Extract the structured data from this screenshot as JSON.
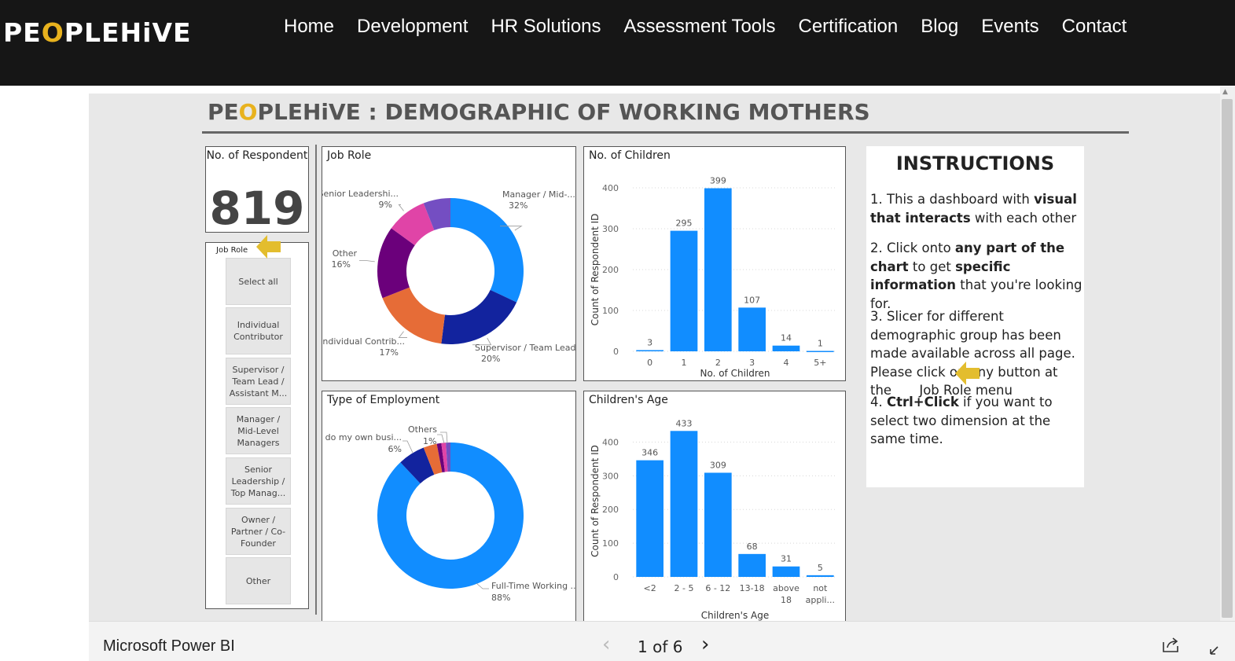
{
  "site": {
    "logo_pre": "PE",
    "logo_o": "O",
    "logo_post": "PLEHiVE",
    "nav": [
      "Home",
      "Development",
      "HR Solutions",
      "Assessment Tools",
      "Certification",
      "Blog",
      "Events",
      "Contact"
    ]
  },
  "report": {
    "logo_pre": "PE",
    "logo_o": "O",
    "logo_post": "PLEHiVE",
    "title_suffix": " : DEMOGRAPHIC OF WORKING MOTHERS",
    "kpi_title": "No. of Respondent",
    "kpi_value": "819",
    "slicer_label": "Job Role",
    "slicer_items": [
      "Select all",
      "Individual Contributor",
      "Supervisor / Team Lead / Assistant M...",
      "Manager / Mid-Level Managers",
      "Senior Leadership / Top Manag...",
      "Owner / Partner / Co-Founder",
      "Other"
    ],
    "instructions": {
      "title": "INSTRUCTIONS",
      "p1_a": "1. This a dashboard with ",
      "p1_b": "visual that interacts",
      "p1_c": " with each other",
      "p2_a": "2. Click onto ",
      "p2_b": "any part of the chart",
      "p2_c": " to get ",
      "p2_d": "specific information",
      "p2_e": " that you're looking for.",
      "p3": "3. Slicer for different demographic group has been made available across all page. Please click on any button at the",
      "p3_end": "Job Role menu",
      "p4_a": "4. ",
      "p4_b": "Ctrl+Click",
      "p4_c": " if you want to select two dimension at the same time."
    }
  },
  "colors": {
    "accent": "#118dff",
    "dark_blue": "#12239e",
    "orange": "#e66c37",
    "purple": "#6b007b",
    "pink": "#e044a7",
    "violet": "#744ec2",
    "logo_gold": "#e8b21e",
    "arrow_gold": "#e3bd2e"
  },
  "chart_data": [
    {
      "type": "pie",
      "title": "Job Role",
      "donut": true,
      "slices": [
        {
          "label": "Manager / Mid-...",
          "pct": 32,
          "color": "#118dff"
        },
        {
          "label": "Supervisor / Team Lead...",
          "pct": 20,
          "color": "#12239e"
        },
        {
          "label": "Individual Contrib...",
          "pct": 17,
          "color": "#e66c37"
        },
        {
          "label": "Other",
          "pct": 16,
          "color": "#6b007b"
        },
        {
          "label": "Senior Leadershi...",
          "pct": 9,
          "color": "#e044a7"
        },
        {
          "label": "Owner / Partner / Co-Founder",
          "pct": 6,
          "color": "#744ec2"
        }
      ]
    },
    {
      "type": "bar",
      "title": "No. of Children",
      "xlabel": "No. of Children",
      "ylabel": "Count of Respondent ID",
      "categories": [
        "0",
        "1",
        "2",
        "3",
        "4",
        "5+"
      ],
      "values": [
        3,
        295,
        399,
        107,
        14,
        1
      ],
      "yticks": [
        0,
        100,
        200,
        300,
        400
      ],
      "ylim": [
        0,
        400
      ]
    },
    {
      "type": "pie",
      "title": "Type of Employment",
      "donut": true,
      "slices": [
        {
          "label": "Full-Time Working ...",
          "pct": 88,
          "color": "#118dff"
        },
        {
          "label": "I do my own busi...",
          "pct": 6,
          "color": "#12239e"
        },
        {
          "label": "Others",
          "pct": 3,
          "color": "#e66c37"
        },
        {
          "label": "",
          "pct": 1,
          "color": "#6b007b"
        },
        {
          "label": "",
          "pct": 1,
          "color": "#e044a7"
        },
        {
          "label": "",
          "pct": 1,
          "color": "#744ec2"
        }
      ],
      "shown_labels": [
        {
          "label": "Full-Time Working ...",
          "text": "88%"
        },
        {
          "label": "I do my own busi...",
          "text": "6%"
        },
        {
          "label": "Others",
          "text": "1%"
        }
      ]
    },
    {
      "type": "bar",
      "title": "Children's Age",
      "xlabel": "Children's Age",
      "ylabel": "Count of Respondent ID",
      "categories": [
        "<2",
        "2 - 5",
        "6 - 12",
        "13-18",
        "above 18",
        "not appli..."
      ],
      "values": [
        346,
        433,
        309,
        68,
        31,
        5
      ],
      "yticks": [
        0,
        100,
        200,
        300,
        400
      ],
      "ylim": [
        0,
        450
      ]
    }
  ],
  "footer": {
    "brand": "Microsoft Power BI",
    "page_indicator": "1 of 6"
  }
}
